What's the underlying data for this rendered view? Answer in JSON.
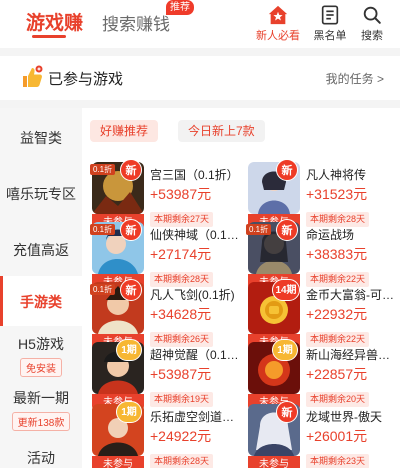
{
  "header": {
    "tab_main": "游戏赚",
    "tab_search": "搜索赚钱",
    "tab_search_badge": "推荐",
    "buttons": [
      {
        "label": "新人必看",
        "icon": "house-star-icon",
        "active": true
      },
      {
        "label": "黑名单",
        "icon": "list-icon",
        "active": false
      },
      {
        "label": "搜索",
        "icon": "search-icon",
        "active": false
      }
    ],
    "accent_color": "#e8412c"
  },
  "joined": {
    "title": "已参与游戏",
    "my_task": "我的任务 >"
  },
  "sidebar": {
    "items": [
      {
        "label": "益智类"
      },
      {
        "label": "嘻乐玩专区"
      },
      {
        "label": "充值高返"
      },
      {
        "label": "手游类",
        "active": true
      },
      {
        "label": "H5游戏",
        "pill": "免安装"
      },
      {
        "label": "最新一期",
        "pill": "更新138款"
      },
      {
        "label": "活动"
      }
    ]
  },
  "filters": {
    "hot": "好赚推荐",
    "today": "今日新上7款"
  },
  "games": [
    {
      "name": "宫三国（0.1折）",
      "reward": "+53987元",
      "remain": "本期剩余27天",
      "status": "未参与",
      "corner": "新",
      "tag": "0.1折"
    },
    {
      "name": "凡人神将传",
      "reward": "+31523元",
      "remain": "本期剩余28天",
      "status": "未参与",
      "corner": "新",
      "tag": ""
    },
    {
      "name": "仙侠神域（0.1折）",
      "reward": "+27174元",
      "remain": "本期剩余28天",
      "status": "未参与",
      "corner": "新",
      "tag": "0.1折"
    },
    {
      "name": "命运战场",
      "reward": "+38383元",
      "remain": "本期剩余22天",
      "status": "未参与",
      "corner": "新",
      "tag": "0.1折"
    },
    {
      "name": "凡人飞剑(0.1折)",
      "reward": "+34628元",
      "remain": "本期剩余26天",
      "status": "未参与",
      "corner": "新",
      "tag": "0.1折"
    },
    {
      "name": "金币大富翁-可…",
      "reward": "+22932元",
      "remain": "本期剩余22天",
      "status": "未参与",
      "corner": "14期",
      "tag": ""
    },
    {
      "name": "超神觉醒（0.1…",
      "reward": "+53987元",
      "remain": "本期剩余19天",
      "status": "未参与",
      "corner": "1期",
      "tag": ""
    },
    {
      "name": "新山海经异兽…",
      "reward": "+22857元",
      "remain": "本期剩余20天",
      "status": "未参与",
      "corner": "1期",
      "tag": ""
    },
    {
      "name": "乐拓虚空剑道…",
      "reward": "+24922元",
      "remain": "本期剩余28天",
      "status": "未参与",
      "corner": "1期",
      "tag": ""
    },
    {
      "name": "龙域世界-傲天",
      "reward": "+26001元",
      "remain": "本期剩余23天",
      "status": "未参与",
      "corner": "新",
      "tag": ""
    }
  ]
}
